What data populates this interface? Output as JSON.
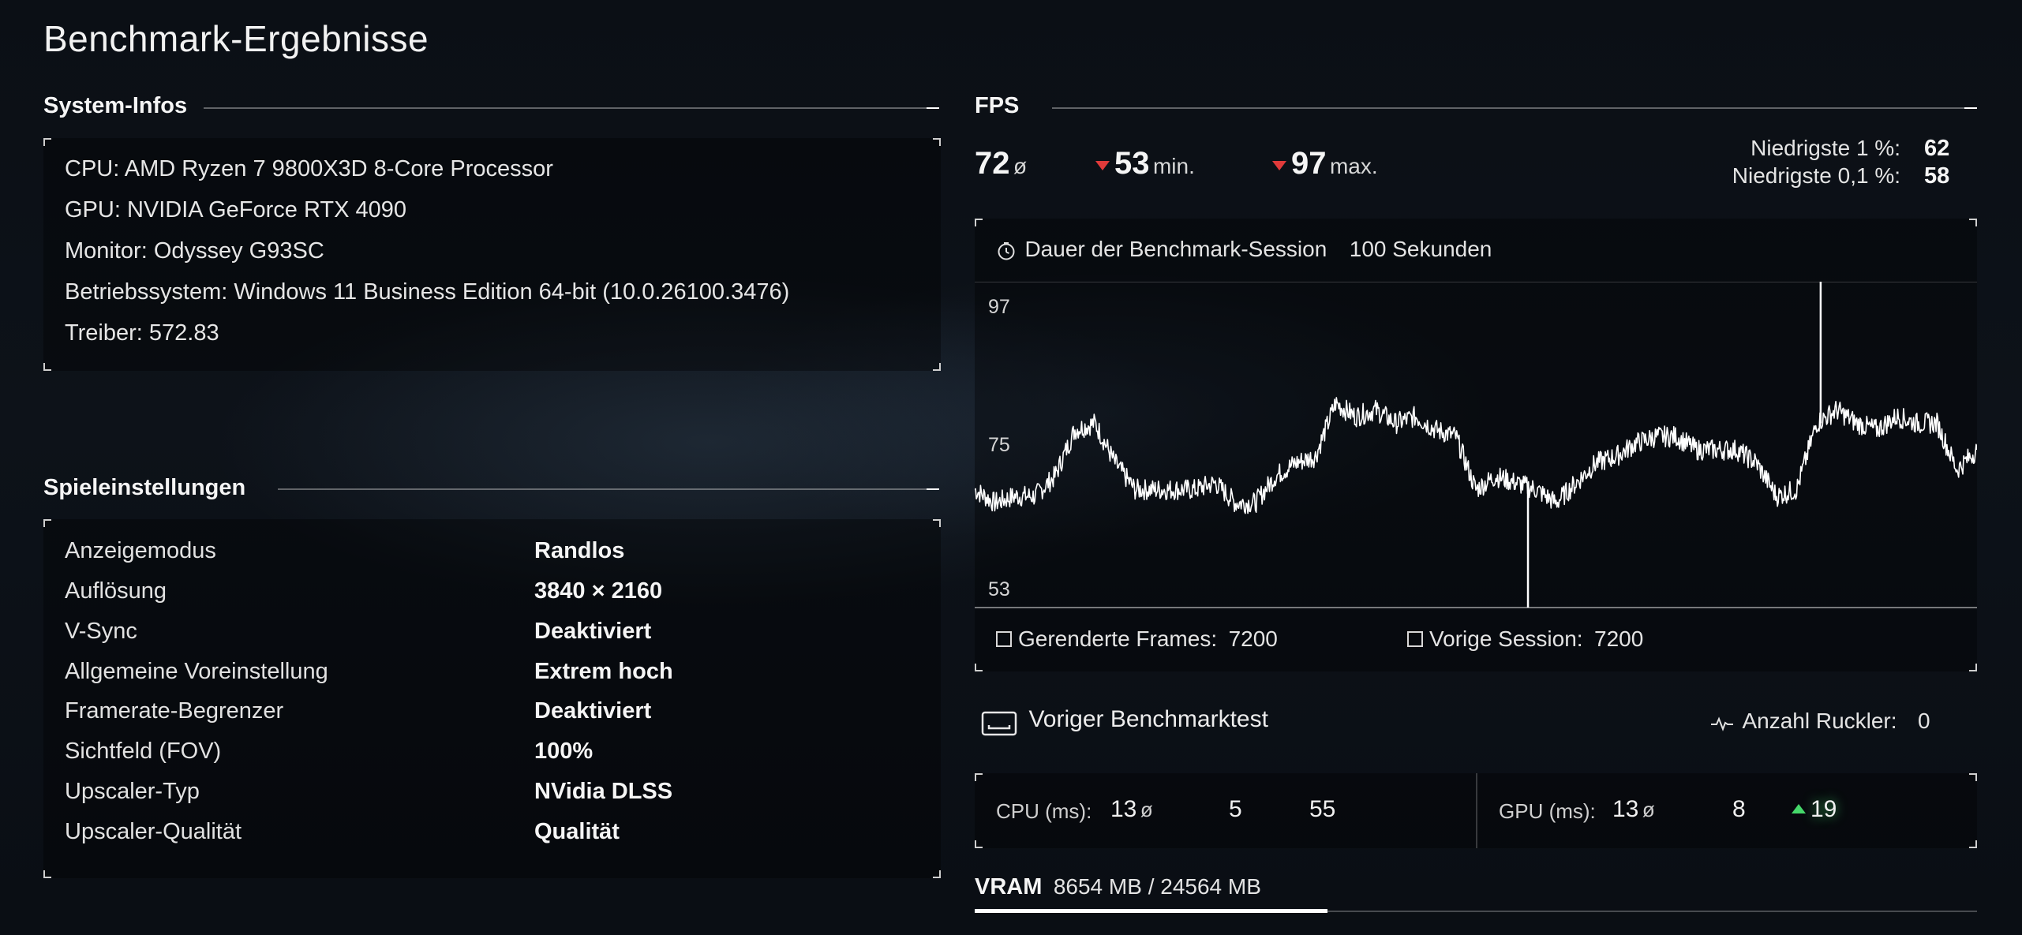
{
  "page_title": "Benchmark-Ergebnisse",
  "system": {
    "heading": "System-Infos",
    "lines": [
      "CPU: AMD Ryzen 7 9800X3D 8-Core Processor",
      "GPU: NVIDIA GeForce RTX 4090",
      "Monitor: Odyssey G93SC",
      "Betriebssystem: Windows 11 Business Edition 64-bit (10.0.26100.3476)",
      "Treiber: 572.83"
    ]
  },
  "settings": {
    "heading": "Spieleinstellungen",
    "rows": [
      {
        "label": "Anzeigemodus",
        "value": "Randlos"
      },
      {
        "label": "Auflösung",
        "value": "3840 × 2160"
      },
      {
        "label": "V-Sync",
        "value": "Deaktiviert"
      },
      {
        "label": "Allgemeine Voreinstellung",
        "value": "Extrem hoch"
      },
      {
        "label": "Framerate-Begrenzer",
        "value": "Deaktiviert"
      },
      {
        "label": "Sichtfeld (FOV)",
        "value": "100%"
      },
      {
        "label": "Upscaler-Typ",
        "value": "NVidia DLSS"
      },
      {
        "label": "Upscaler-Qualität",
        "value": "Qualität"
      }
    ]
  },
  "fps": {
    "heading": "FPS",
    "avg": "72",
    "avg_unit": "ø",
    "min": "53",
    "min_unit": "min.",
    "max": "97",
    "max_unit": "max.",
    "low1_label": "Niedrigste 1 %:",
    "low1_value": "62",
    "low01_label": "Niedrigste 0,1 %:",
    "low01_value": "58",
    "duration_label": "Dauer der Benchmark-Session",
    "duration_value": "100 Sekunden",
    "rendered_label": "Gerenderte Frames:",
    "rendered_value": "7200",
    "previous_label": "Vorige Session:",
    "previous_value": "7200",
    "prev_test_label": "Voriger Benchmarktest",
    "stutter_label": "Anzahl Ruckler:",
    "stutter_value": "0"
  },
  "frametimes": {
    "cpu_label": "CPU (ms):",
    "cpu_avg": "13",
    "cpu_avg_unit": "ø",
    "cpu_min": "5",
    "cpu_max": "55",
    "gpu_label": "GPU (ms):",
    "gpu_avg": "13",
    "gpu_avg_unit": "ø",
    "gpu_min": "8",
    "gpu_max": "19"
  },
  "vram": {
    "label": "VRAM",
    "value": "8654 MB / 24564 MB",
    "fraction": 0.352
  },
  "colors": {
    "accent_down": "#e03a3a",
    "accent_up": "#45d86a",
    "line": "#ffffff"
  },
  "chart_data": {
    "type": "line",
    "x_label": "",
    "y_label": "",
    "ylim": [
      53,
      97
    ],
    "yticks": [
      "97",
      "75",
      "53"
    ],
    "x": [
      0,
      2,
      4,
      6,
      8,
      10,
      12,
      14,
      16,
      18,
      20,
      22,
      24,
      26,
      28,
      30,
      32,
      34,
      36,
      38,
      40,
      42,
      44,
      46,
      48,
      50,
      52,
      54,
      56,
      58,
      60,
      62,
      64,
      66,
      68,
      70,
      72,
      74,
      76,
      78,
      80,
      82,
      84,
      86,
      88,
      90,
      92,
      94,
      96,
      98,
      100
    ],
    "series": [
      {
        "values": [
          69,
          67,
          68,
          68,
          71,
          78,
          79,
          73,
          69,
          69,
          69,
          69,
          70,
          67,
          67,
          71,
          73,
          74,
          82,
          80,
          81,
          79,
          80,
          78,
          77,
          69,
          71,
          70,
          69,
          67,
          70,
          73,
          74,
          76,
          77,
          77,
          75,
          75,
          75,
          73,
          68,
          69,
          79,
          81,
          79,
          78,
          80,
          79,
          79,
          72,
          75
        ]
      }
    ],
    "spikes": [
      {
        "x": 55.2,
        "value": 53
      },
      {
        "x": 84.4,
        "value": 97
      }
    ]
  }
}
